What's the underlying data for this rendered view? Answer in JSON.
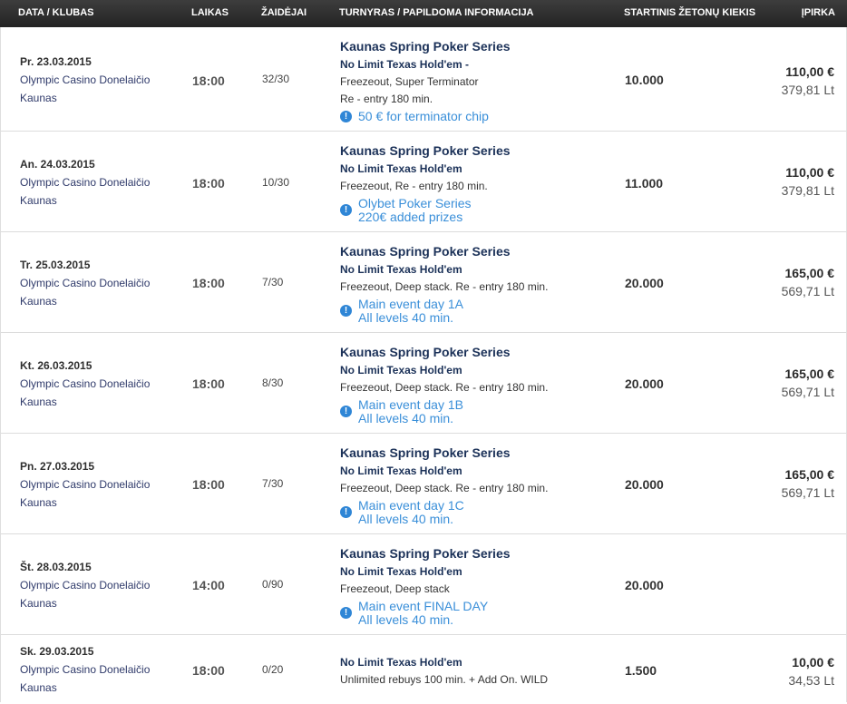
{
  "columns": {
    "date": "DATA / KLUBAS",
    "time": "LAIKAS",
    "players": "ŽAIDĖJAI",
    "tournament": "TURNYRAS / PAPILDOMA INFORMACIJA",
    "chips": "STARTINIS ŽETONŲ KIEKIS",
    "buyin": "ĮPIRKA"
  },
  "rows": [
    {
      "date": "Pr. 23.03.2015",
      "club": "Olympic Casino Donelaičio",
      "city": "Kaunas",
      "time": "18:00",
      "players": "32/30",
      "series": "Kaunas Spring Poker Series",
      "game": "No Limit Texas Hold'em -",
      "info": [
        "Freezeout, Super Terminator",
        "Re - entry 180 min."
      ],
      "note": [
        "50 € for terminator chip"
      ],
      "chips": "10.000",
      "eur": "110,00 €",
      "lt": "379,81 Lt"
    },
    {
      "date": "An. 24.03.2015",
      "club": "Olympic Casino Donelaičio",
      "city": "Kaunas",
      "time": "18:00",
      "players": "10/30",
      "series": "Kaunas Spring Poker Series",
      "game": "No Limit Texas Hold'em",
      "info": [
        "Freezeout, Re - entry 180 min."
      ],
      "note": [
        "Olybet Poker Series",
        "220€ added prizes"
      ],
      "chips": "11.000",
      "eur": "110,00 €",
      "lt": "379,81 Lt"
    },
    {
      "date": "Tr. 25.03.2015",
      "club": "Olympic Casino Donelaičio",
      "city": "Kaunas",
      "time": "18:00",
      "players": "7/30",
      "series": "Kaunas Spring Poker Series",
      "game": "No Limit Texas Hold'em",
      "info": [
        "Freezeout, Deep stack. Re - entry 180 min."
      ],
      "note": [
        "Main event day 1A",
        "All levels 40 min."
      ],
      "chips": "20.000",
      "eur": "165,00 €",
      "lt": "569,71 Lt"
    },
    {
      "date": "Kt. 26.03.2015",
      "club": "Olympic Casino Donelaičio",
      "city": "Kaunas",
      "time": "18:00",
      "players": "8/30",
      "series": "Kaunas Spring Poker Series",
      "game": "No Limit Texas Hold'em",
      "info": [
        "Freezeout, Deep stack. Re - entry 180 min."
      ],
      "note": [
        "Main event day 1B",
        "All levels 40 min."
      ],
      "chips": "20.000",
      "eur": "165,00 €",
      "lt": "569,71 Lt"
    },
    {
      "date": "Pn. 27.03.2015",
      "club": "Olympic Casino Donelaičio",
      "city": "Kaunas",
      "time": "18:00",
      "players": "7/30",
      "series": "Kaunas Spring Poker Series",
      "game": "No Limit Texas Hold'em",
      "info": [
        "Freezeout, Deep stack. Re - entry 180 min."
      ],
      "note": [
        "Main event day 1C",
        "All levels 40 min."
      ],
      "chips": "20.000",
      "eur": "165,00 €",
      "lt": "569,71 Lt"
    },
    {
      "date": "Št. 28.03.2015",
      "club": "Olympic Casino Donelaičio",
      "city": "Kaunas",
      "time": "14:00",
      "players": "0/90",
      "series": "Kaunas Spring Poker Series",
      "game": "No Limit Texas Hold'em",
      "info": [
        "Freezeout, Deep stack"
      ],
      "note": [
        "Main event FINAL DAY",
        "All levels 40 min."
      ],
      "chips": "20.000",
      "eur": "",
      "lt": ""
    },
    {
      "date": "Sk. 29.03.2015",
      "club": "Olympic Casino Donelaičio",
      "city": "Kaunas",
      "time": "18:00",
      "players": "0/20",
      "series": "",
      "game": "No Limit Texas Hold'em",
      "info": [
        "Unlimited rebuys 100 min. + Add On. WILD"
      ],
      "note": [],
      "chips": "1.500",
      "eur": "10,00 €",
      "lt": "34,53 Lt"
    }
  ]
}
